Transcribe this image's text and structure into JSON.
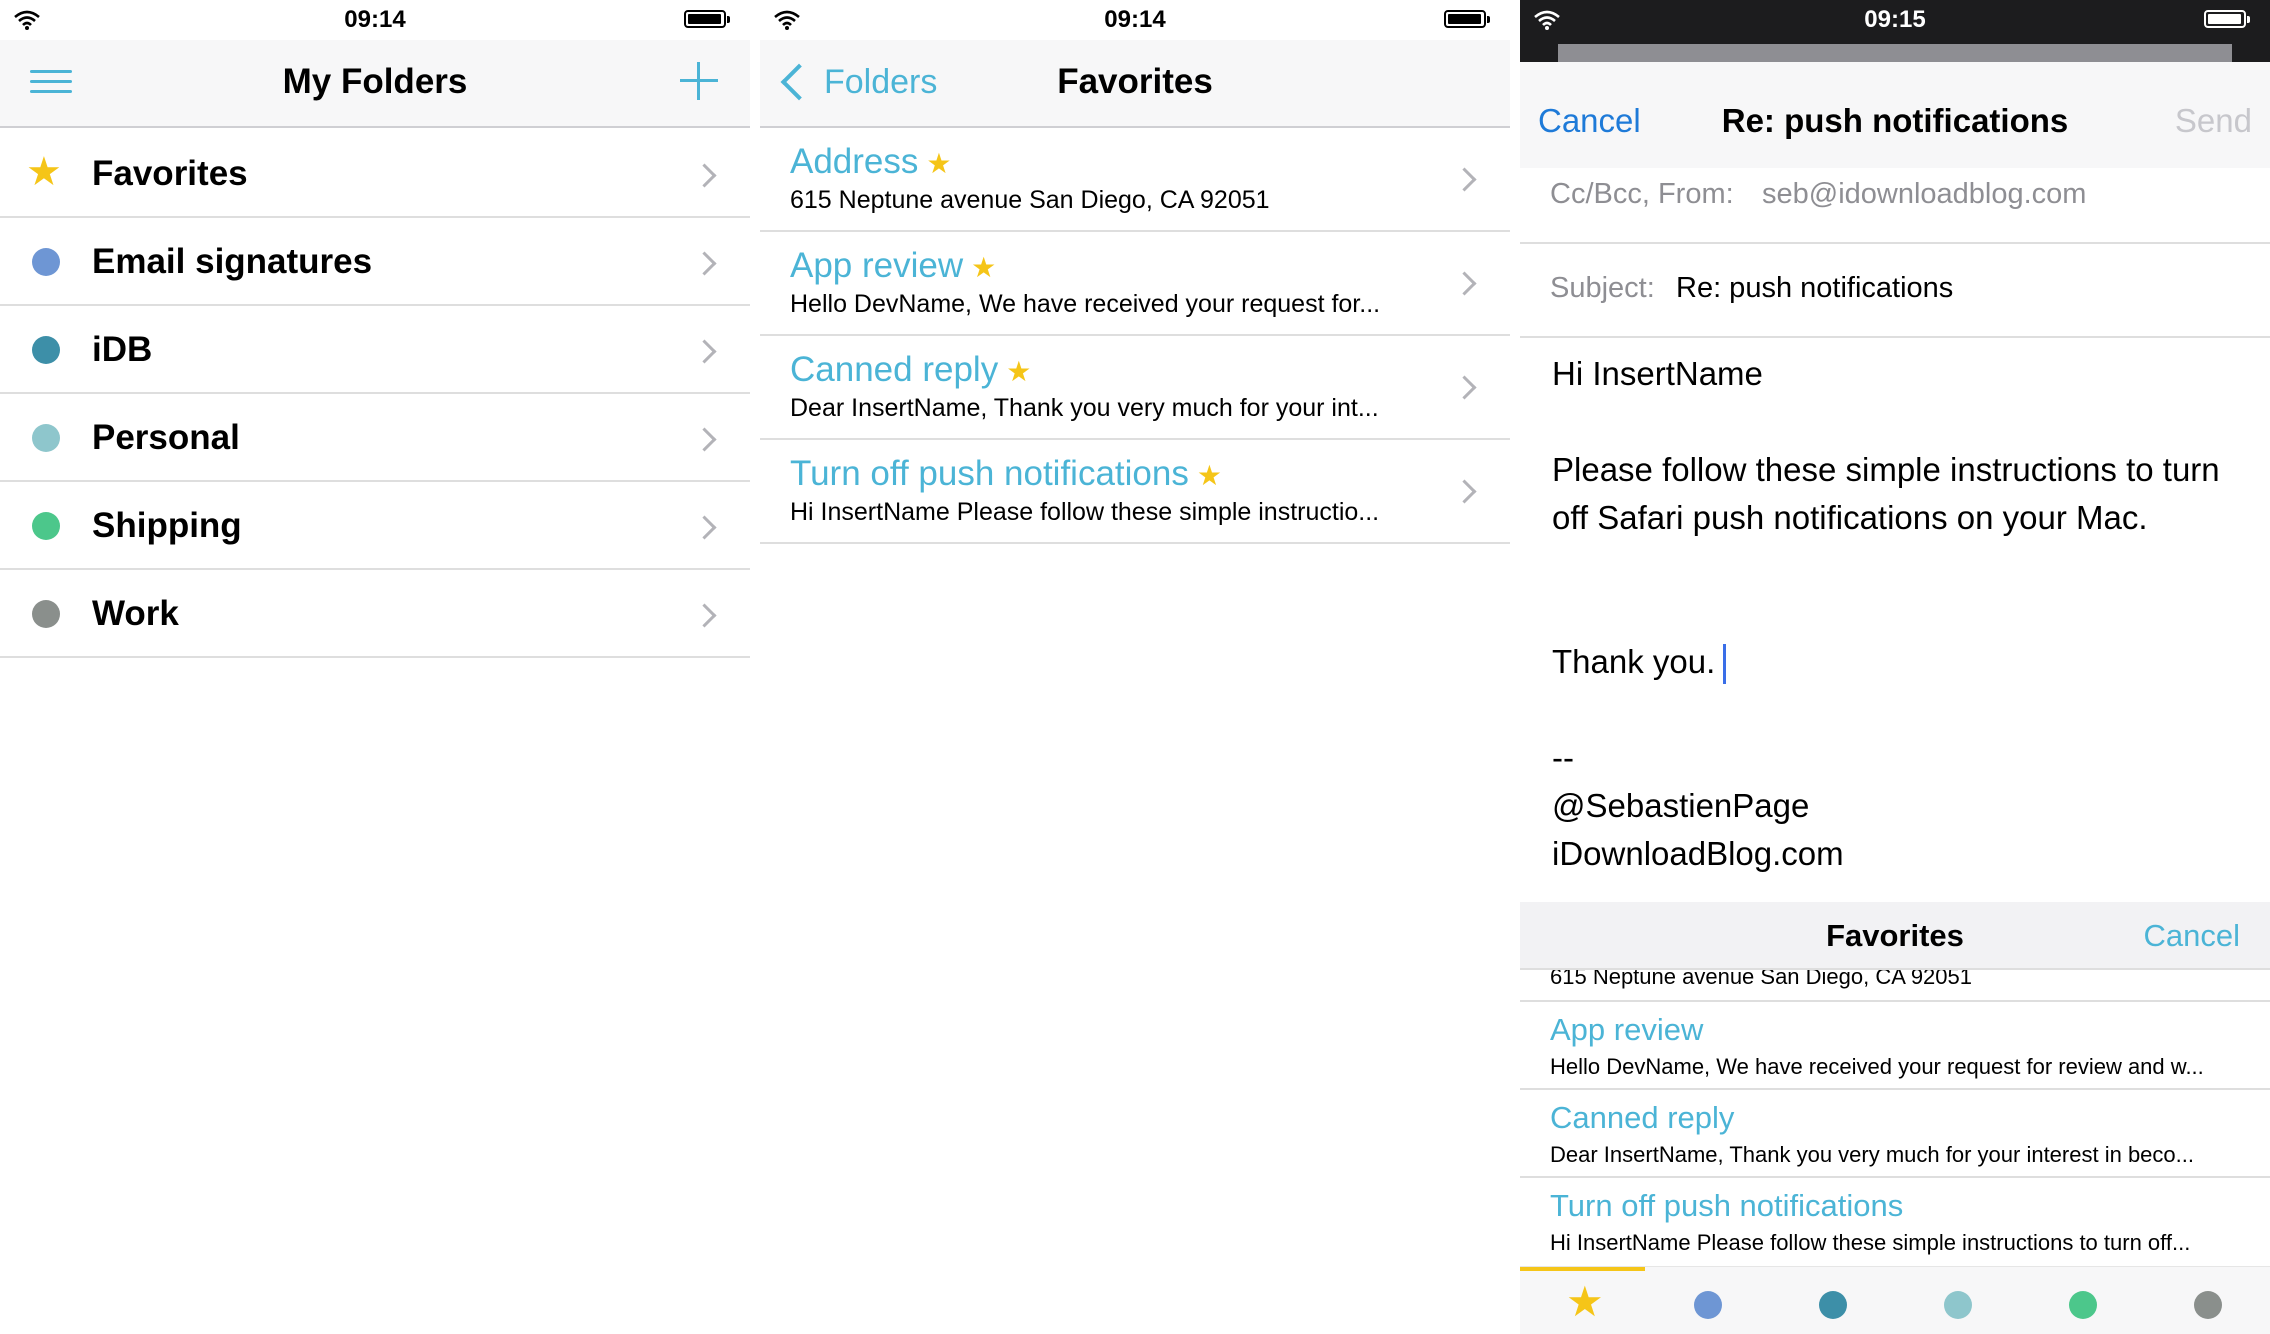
{
  "status": {
    "time_left": "09:14",
    "time_middle": "09:14",
    "time_right": "09:15"
  },
  "folders_screen": {
    "title": "My Folders",
    "menu_icon": "hamburger-menu-icon",
    "add_icon": "plus-icon",
    "items": [
      {
        "label": "Favorites",
        "icon": "star",
        "color": "#f5c518"
      },
      {
        "label": "Email signatures",
        "color": "#6e96d4"
      },
      {
        "label": "iDB",
        "color": "#3d8fa8"
      },
      {
        "label": "Personal",
        "color": "#8ec6cc"
      },
      {
        "label": "Shipping",
        "color": "#4cc78b"
      },
      {
        "label": "Work",
        "color": "#8a8f8c"
      }
    ]
  },
  "favorites_screen": {
    "back_label": "Folders",
    "title": "Favorites",
    "items": [
      {
        "title": "Address",
        "body": "615 Neptune avenue San Diego, CA 92051"
      },
      {
        "title": "App review",
        "body": "Hello DevName, We have received your request for..."
      },
      {
        "title": "Canned reply",
        "body": "Dear InsertName, Thank you very much for your int..."
      },
      {
        "title": "Turn off push notifications",
        "body": "Hi InsertName Please follow these simple instructio..."
      }
    ]
  },
  "compose_screen": {
    "cancel_label": "Cancel",
    "title": "Re: push notifications",
    "send_label": "Send",
    "ccbcc_label": "Cc/Bcc, From:",
    "from_value": "seb@idownloadblog.com",
    "subject_label": "Subject:",
    "subject_value": "Re: push notifications",
    "body_greeting": "Hi InsertName",
    "body_paragraph": "Please follow these simple instructions to turn off Safari push notifications on your Mac.",
    "body_thanks": "Thank you.",
    "signature_dashes": "--",
    "signature_handle": "@SebastienPage",
    "signature_site": "iDownloadBlog.com",
    "sheet": {
      "title": "Favorites",
      "cancel_label": "Cancel",
      "partial_row": "615 Neptune avenue San Diego, CA 92051",
      "items": [
        {
          "title": "App review",
          "body": "Hello DevName, We have received your request for review and w..."
        },
        {
          "title": "Canned reply",
          "body": "Dear InsertName, Thank you very much for your interest in beco..."
        },
        {
          "title": "Turn off push notifications",
          "body": "Hi InsertName Please follow these simple instructions to turn off..."
        }
      ],
      "tabs": [
        {
          "icon": "star",
          "color": "#f5c518",
          "selected": true
        },
        {
          "color": "#6e96d4"
        },
        {
          "color": "#3d8fa8"
        },
        {
          "color": "#8ec6cc"
        },
        {
          "color": "#4cc78b"
        },
        {
          "color": "#8a8f8c"
        }
      ]
    }
  }
}
